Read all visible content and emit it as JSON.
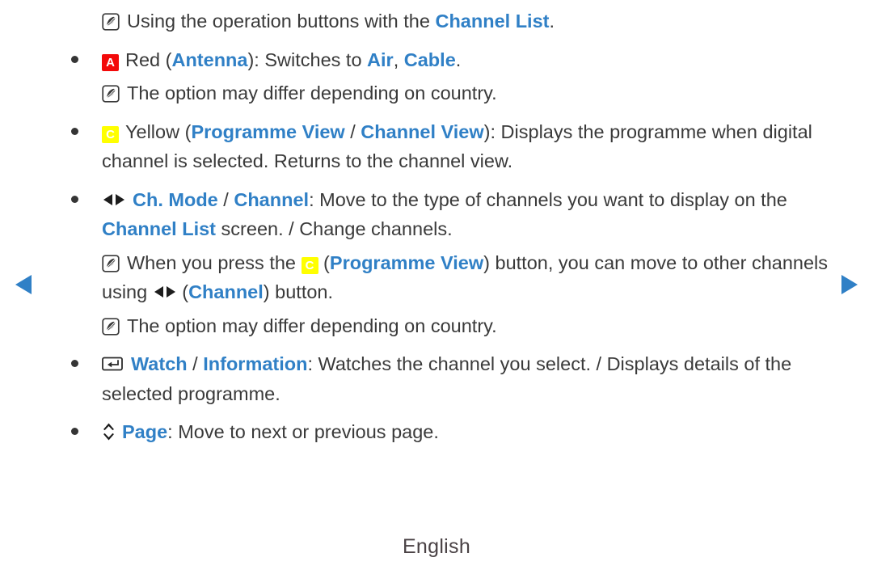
{
  "footer": {
    "language_label": "English"
  },
  "navigation": {
    "prev_label": "Previous page",
    "next_label": "Next page",
    "prev_icon": "triangle-left-icon",
    "next_icon": "triangle-right-icon",
    "arrow_color": "#3080c6"
  },
  "colors": {
    "link_blue": "#3080c6",
    "body_text": "#3a3a3a",
    "red_button": "#f30a0a",
    "yellow_button": "#ffff00",
    "footer_text": "#4a4245"
  },
  "content": {
    "heading_note": {
      "icon": "note-pen-icon",
      "text_before": "Using the operation buttons with the ",
      "link": "Channel List",
      "text_after": "."
    },
    "items": [
      {
        "kind": "bullet",
        "icon": "red-a-button-icon",
        "icon_label": "A",
        "segments": [
          {
            "t": "Red (",
            "s": "plain"
          },
          {
            "t": "Antenna",
            "s": "blue"
          },
          {
            "t": "): Switches to ",
            "s": "plain"
          },
          {
            "t": "Air",
            "s": "blue"
          },
          {
            "t": ", ",
            "s": "plain"
          },
          {
            "t": "Cable",
            "s": "blue"
          },
          {
            "t": ".",
            "s": "plain"
          }
        ]
      },
      {
        "kind": "note",
        "icon": "note-pen-icon",
        "segments": [
          {
            "t": "The option may differ depending on country.",
            "s": "plain"
          }
        ]
      },
      {
        "kind": "bullet",
        "icon": "yellow-c-button-icon",
        "icon_label": "C",
        "segments": [
          {
            "t": "Yellow (",
            "s": "plain"
          },
          {
            "t": "Programme View",
            "s": "blue"
          },
          {
            "t": " / ",
            "s": "plain"
          },
          {
            "t": "Channel View",
            "s": "blue"
          },
          {
            "t": "): Displays the programme when digital channel is selected. Returns to the channel view.",
            "s": "plain"
          }
        ]
      },
      {
        "kind": "bullet",
        "icon": "left-right-arrows-icon",
        "segments": [
          {
            "t": "Ch. Mode",
            "s": "blue"
          },
          {
            "t": " / ",
            "s": "plain"
          },
          {
            "t": "Channel",
            "s": "blue"
          },
          {
            "t": ": Move to the type of channels you want to display on the ",
            "s": "plain"
          },
          {
            "t": "Channel List",
            "s": "blue"
          },
          {
            "t": " screen. / Change channels.",
            "s": "plain"
          }
        ]
      },
      {
        "kind": "note",
        "icon": "note-pen-icon",
        "segments": [
          {
            "t": "When you press the ",
            "s": "plain"
          },
          {
            "t": "C",
            "s": "yellow-key"
          },
          {
            "t": " (",
            "s": "plain"
          },
          {
            "t": "Programme View",
            "s": "blue"
          },
          {
            "t": ") button, you can move to other channels using ",
            "s": "plain"
          },
          {
            "t": "",
            "s": "lr-icon"
          },
          {
            "t": " (",
            "s": "plain"
          },
          {
            "t": "Channel",
            "s": "blue"
          },
          {
            "t": ") button.",
            "s": "plain"
          }
        ]
      },
      {
        "kind": "note",
        "icon": "note-pen-icon",
        "segments": [
          {
            "t": "The option may differ depending on country.",
            "s": "plain"
          }
        ]
      },
      {
        "kind": "bullet",
        "icon": "enter-key-icon",
        "segments": [
          {
            "t": "Watch",
            "s": "blue"
          },
          {
            "t": " / ",
            "s": "plain"
          },
          {
            "t": "Information",
            "s": "blue"
          },
          {
            "t": ": Watches the channel you select. / Displays details of the selected programme.",
            "s": "plain"
          }
        ]
      },
      {
        "kind": "bullet",
        "icon": "up-down-arrows-icon",
        "segments": [
          {
            "t": "Page",
            "s": "blue"
          },
          {
            "t": ": Move to next or previous page.",
            "s": "plain"
          }
        ]
      }
    ]
  }
}
